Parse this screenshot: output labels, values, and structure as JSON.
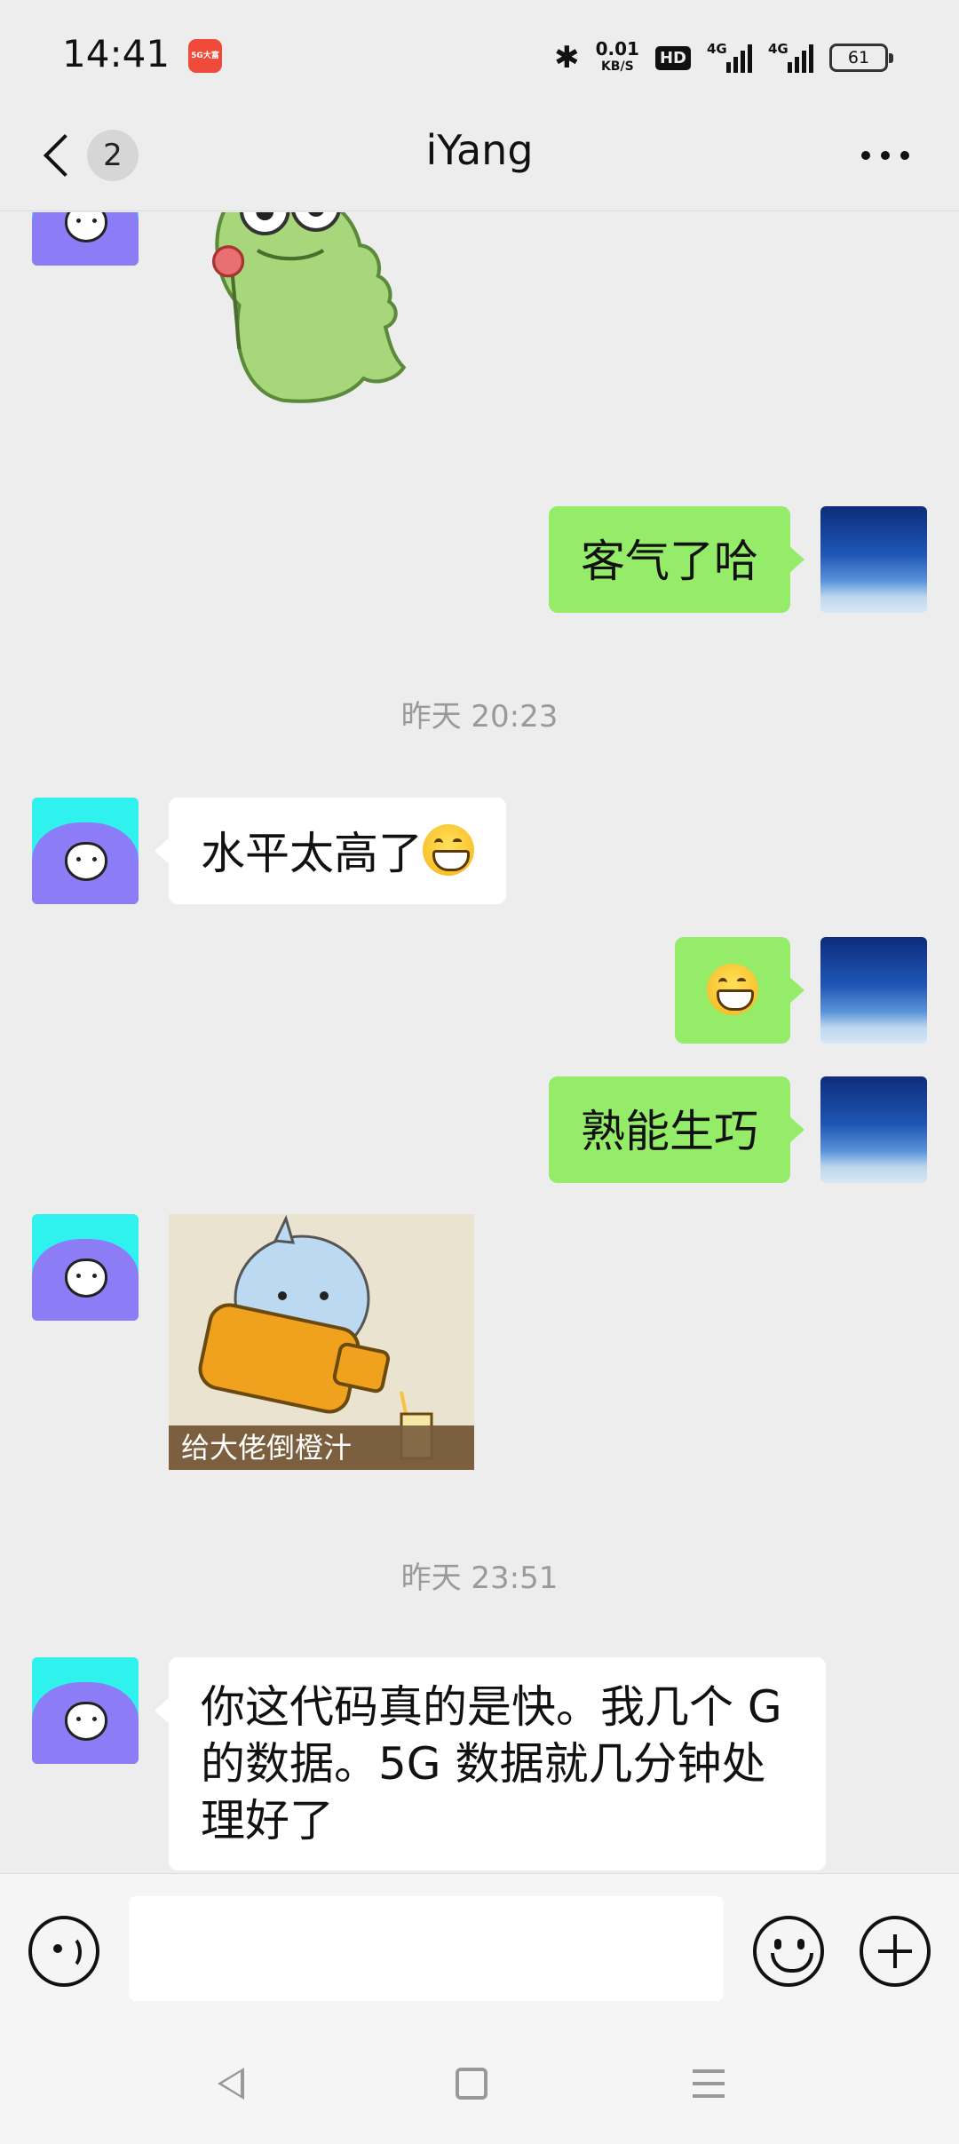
{
  "status_bar": {
    "time": "14:41",
    "app_icon_label": "5G大富",
    "net_speed_value": "0.01",
    "net_speed_unit": "KB/S",
    "hd_label": "HD",
    "signal_1": "4G",
    "signal_2": "4G",
    "battery": "61"
  },
  "header": {
    "unread_count": "2",
    "title": "iYang"
  },
  "messages": {
    "m2": "客气了哈",
    "time1": "昨天 20:23",
    "m3": "水平太高了",
    "m5": "熟能生巧",
    "sticker_caption": "给大佬倒橙汁",
    "time2": "昨天 23:51",
    "m7": "你这代码真的是快。我几个 G 的数据。5G 数据就几分钟处理好了"
  },
  "icons": {
    "back": "chevron-left-icon",
    "more": "more-dots-icon",
    "voice": "voice-icon",
    "emoji": "emoji-icon",
    "plus": "plus-icon"
  },
  "colors": {
    "background": "#ededed",
    "bubble_out": "#95ec69",
    "bubble_in": "#ffffff"
  }
}
